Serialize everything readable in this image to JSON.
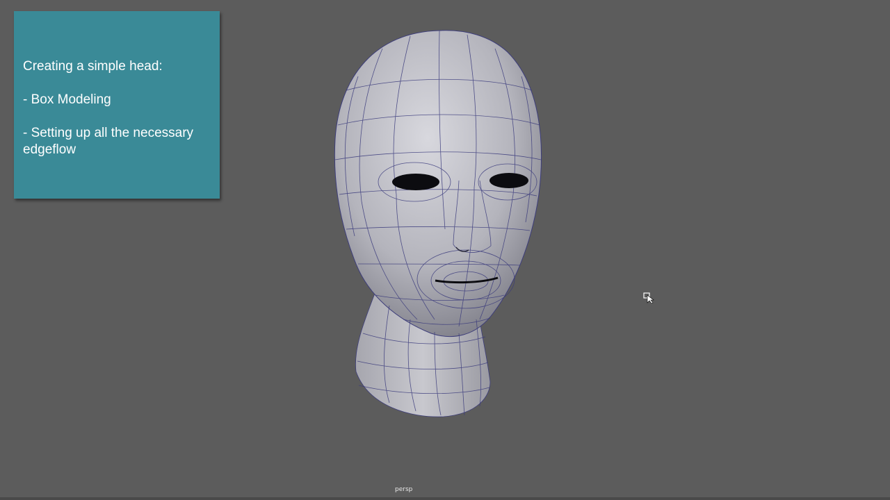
{
  "card": {
    "title": "Creating a simple head:",
    "bullet1": "- Box Modeling",
    "bullet2": "- Setting up all the necessary edgeflow",
    "background": "#3a8a97"
  },
  "viewport": {
    "camera": "persp",
    "background": "#5c5c5c",
    "model": "head-wireframe-mesh"
  }
}
